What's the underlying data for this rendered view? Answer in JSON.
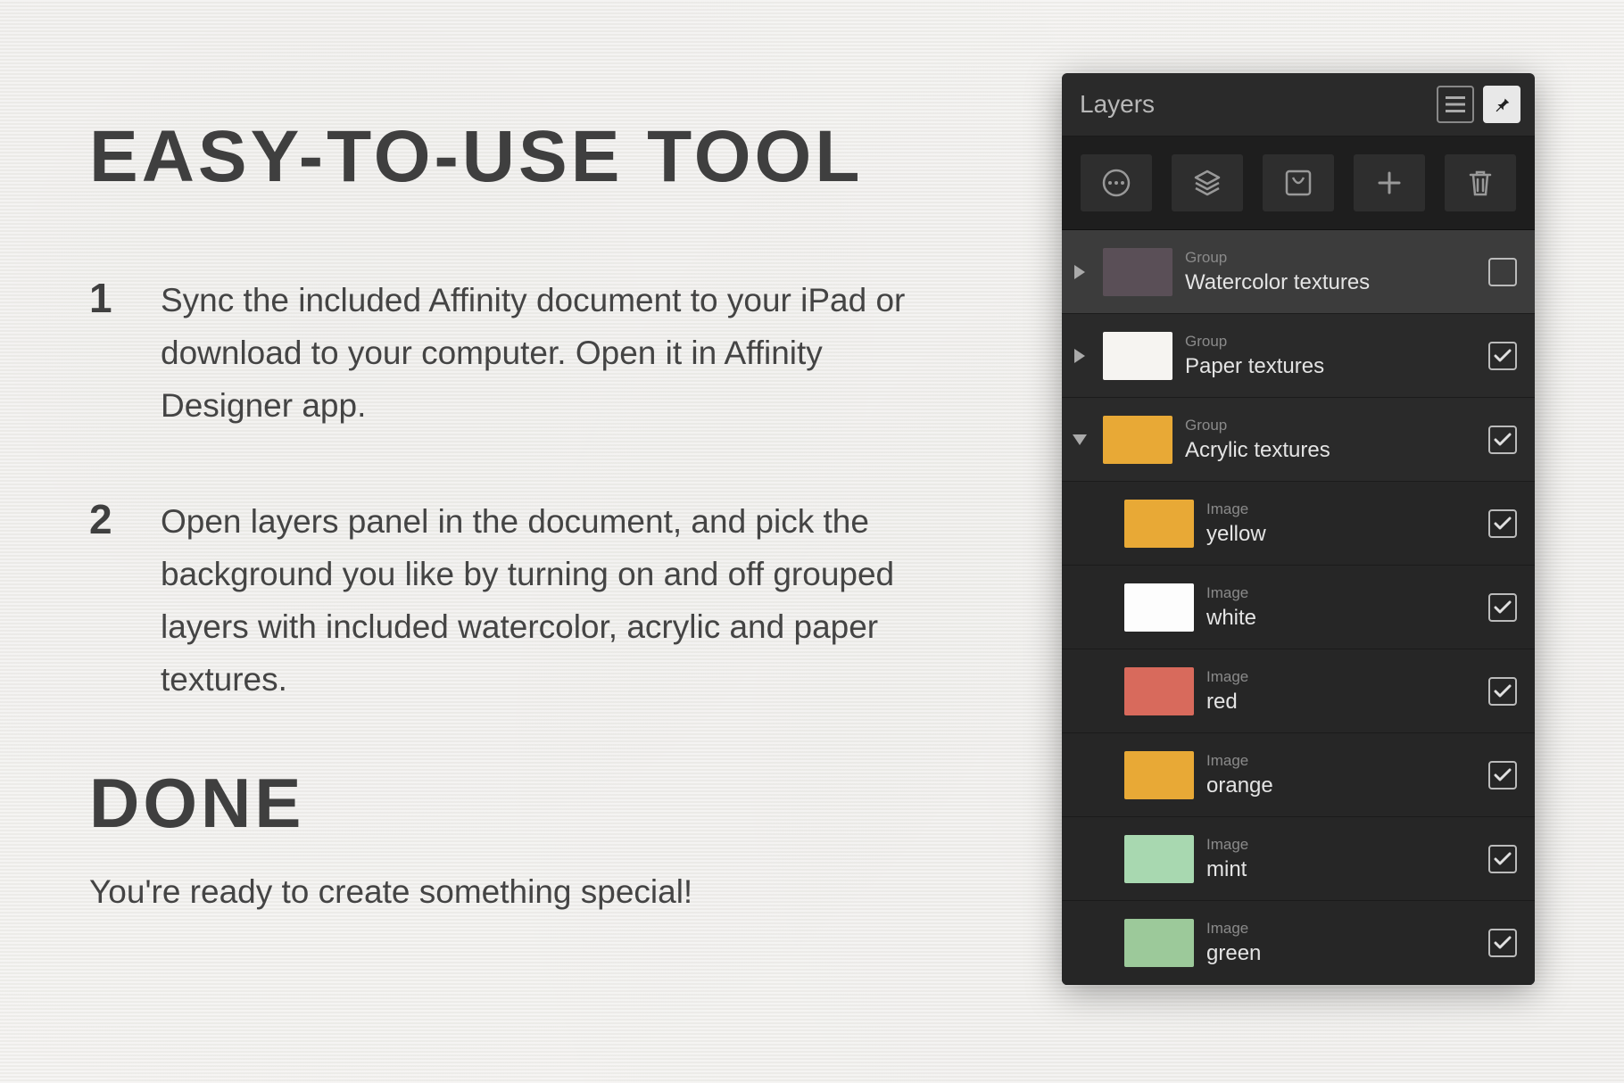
{
  "title": "EASY-TO-USE TOOL",
  "steps": [
    {
      "num": "1",
      "text": "Sync the included Affinity document to your iPad or download to your computer. Open it in Affinity Designer app."
    },
    {
      "num": "2",
      "text": "Open layers panel in the document, and pick the background you like by turning on and off grouped layers with included watercolor, acrylic and paper textures."
    }
  ],
  "done_heading": "DONE",
  "done_text": "You're ready to create something special!",
  "panel": {
    "title": "Layers",
    "layers": [
      {
        "type": "Group",
        "name": "Watercolor textures",
        "expanded": false,
        "checked": false,
        "selected": true,
        "swatch": "#5a4f57",
        "child": false
      },
      {
        "type": "Group",
        "name": "Paper textures",
        "expanded": false,
        "checked": true,
        "selected": false,
        "swatch": "#f6f4f1",
        "child": false
      },
      {
        "type": "Group",
        "name": "Acrylic textures",
        "expanded": true,
        "checked": true,
        "selected": false,
        "swatch": "#e8a936",
        "child": false
      },
      {
        "type": "Image",
        "name": "yellow",
        "checked": true,
        "swatch": "#e8a936",
        "child": true
      },
      {
        "type": "Image",
        "name": "white",
        "checked": true,
        "swatch": "#fdfdfd",
        "child": true
      },
      {
        "type": "Image",
        "name": "red",
        "checked": true,
        "swatch": "#d86a5c",
        "child": true
      },
      {
        "type": "Image",
        "name": "orange",
        "checked": true,
        "swatch": "#e8a936",
        "child": true
      },
      {
        "type": "Image",
        "name": "mint",
        "checked": true,
        "swatch": "#a8d8b0",
        "child": true
      },
      {
        "type": "Image",
        "name": "green",
        "checked": true,
        "swatch": "#9cc99a",
        "child": true
      }
    ]
  }
}
